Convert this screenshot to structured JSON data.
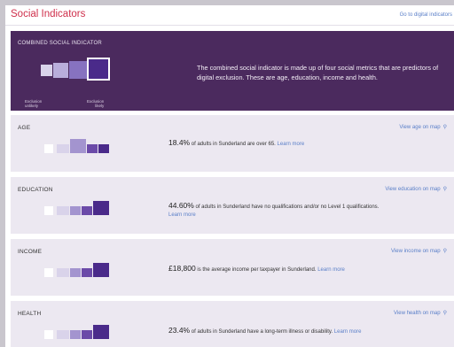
{
  "header": {
    "title": "Social Indicators",
    "goto_link": "Go to digital indicators"
  },
  "combined": {
    "label": "COMBINED SOCIAL INDICATOR",
    "description": "The combined social indicator is made up of four social metrics that are predictors of digital exclusion. These are age, education, income and health.",
    "legend_low_line1": "Exclusion",
    "legend_low_line2": "unlikely",
    "legend_high_line1": "Exclusion",
    "legend_high_line2": "likely"
  },
  "colors": {
    "title": "#cf2f4b",
    "link": "#5a7fc8",
    "banner": "#4b2a5e",
    "card": "#ece8f1",
    "scale": [
      "#ffffff",
      "#d9d3ea",
      "#a394cf",
      "#6b4aa8",
      "#4a2a8a"
    ]
  },
  "indicators": [
    {
      "name": "AGE",
      "map_link": "View age on map",
      "value": "18.4%",
      "text_pre": "of adults in Sunderland are",
      "text_em": "over 65.",
      "text_post": "",
      "learn_more": "Learn more",
      "level": 3,
      "pin_icon": "map-pin-icon"
    },
    {
      "name": "EDUCATION",
      "map_link": "View education on map",
      "value": "44.60%",
      "text_pre": "of adults in Sunderland have",
      "text_em": "no qualifications and/or no Level 1 qualifications.",
      "text_post": "",
      "learn_more": "Learn more",
      "level": 5,
      "pin_icon": "map-pin-icon"
    },
    {
      "name": "INCOME",
      "map_link": "View income on map",
      "value": "£18,800",
      "text_pre": "is the",
      "text_em": "average income per taxpayer",
      "text_post": "in Sunderland.",
      "learn_more": "Learn more",
      "level": 5,
      "pin_icon": "map-pin-icon"
    },
    {
      "name": "HEALTH",
      "map_link": "View health on map",
      "value": "23.4%",
      "text_pre": "of adults in Sunderland have a",
      "text_em": "long-term illness or disability.",
      "text_post": "",
      "learn_more": "Learn more",
      "level": 5,
      "pin_icon": "map-pin-icon"
    }
  ]
}
